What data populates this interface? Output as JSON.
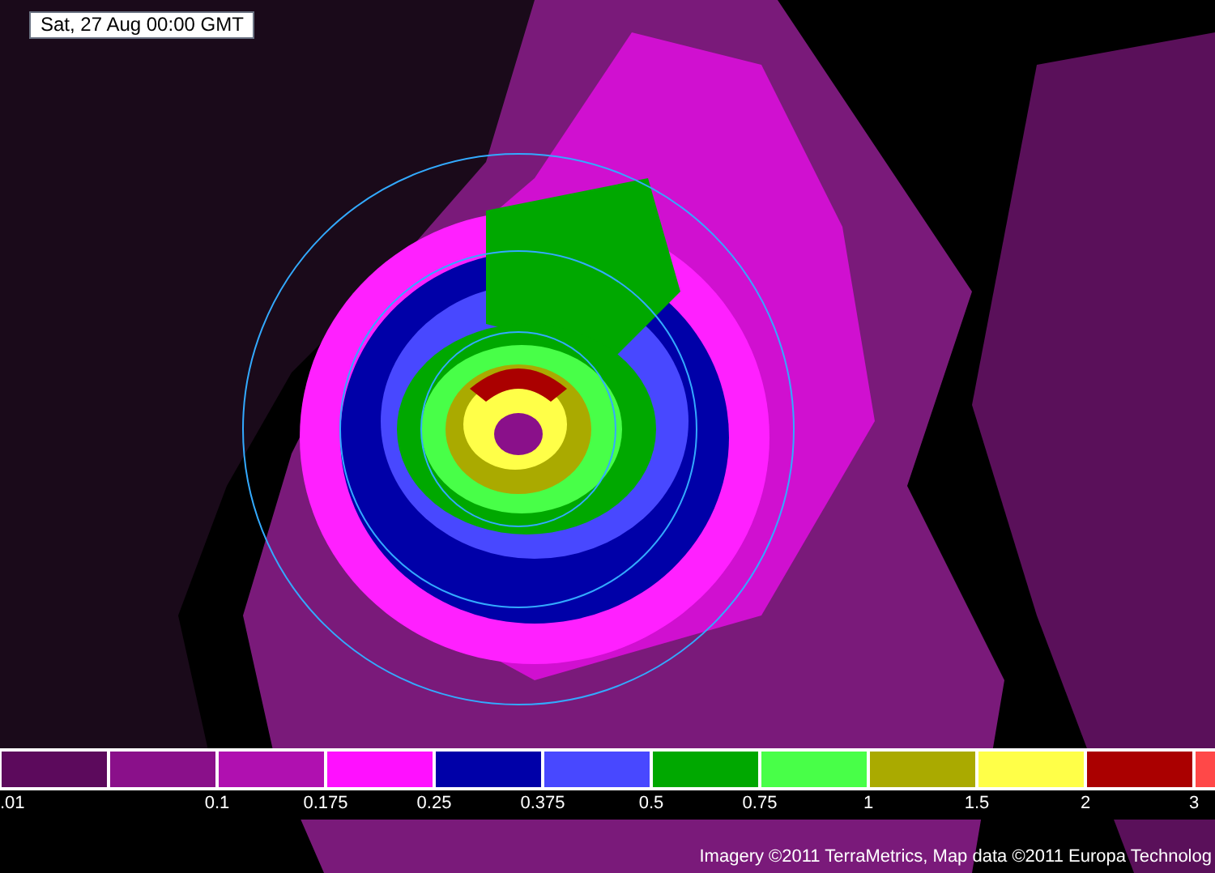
{
  "timestamp": "Sat, 27 Aug 00:00 GMT",
  "legend": {
    "start_label": ".01",
    "swatches": [
      {
        "color": "#5c0a5c"
      },
      {
        "color": "#8a108a",
        "label": "0.1"
      },
      {
        "color": "#b010b0",
        "label": "0.175"
      },
      {
        "color": "#ff10ff",
        "label": "0.25"
      },
      {
        "color": "#0000a8",
        "label": "0.375"
      },
      {
        "color": "#4848ff",
        "label": "0.5"
      },
      {
        "color": "#00a800",
        "label": "0.75"
      },
      {
        "color": "#48ff48",
        "label": "1"
      },
      {
        "color": "#aaaa00",
        "label": "1.5"
      },
      {
        "color": "#ffff48",
        "label": "2"
      },
      {
        "color": "#aa0000",
        "label": "3"
      },
      {
        "color": "#ff4848"
      }
    ]
  },
  "attribution": "Imagery ©2011 TerraMetrics, Map data ©2011 Europa Technolog"
}
